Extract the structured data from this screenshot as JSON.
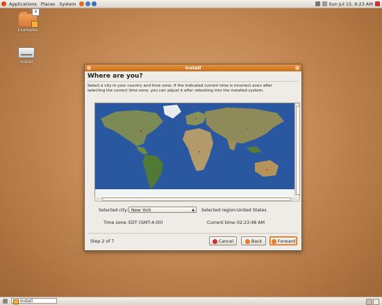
{
  "top_panel": {
    "menus": [
      "Applications",
      "Places",
      "System"
    ],
    "clock": "Sun Jul 15,  6:23 AM"
  },
  "desktop_icons": [
    {
      "label": "Examples",
      "icon": "folder-icon"
    },
    {
      "label": "Install",
      "icon": "drive-icon"
    }
  ],
  "window": {
    "title": "Install",
    "heading": "Where are you?",
    "description": "Select a city in your country and time zone. If the indicated current time is incorrect even after selecting the correct time zone, you can adjust it after rebooting into the installed system.",
    "selected_city_label": "Selected city:",
    "selected_city_value": "New York",
    "selected_region_label": "Selected region:",
    "selected_region_value": "United States",
    "time_zone_label": "Time zone:",
    "time_zone_value": "EDT (GMT-4:00)",
    "current_time_label": "Current time:",
    "current_time_value": "02:23:48 AM",
    "step": "Step 2 of 7",
    "buttons": {
      "cancel": "Cancel",
      "back": "Back",
      "forward": "Forward"
    }
  },
  "taskbar": {
    "task_label": "Install"
  },
  "colors": {
    "accent": "#e07a25",
    "ocean": "#2a58a0",
    "panel": "#e6e1d8"
  }
}
